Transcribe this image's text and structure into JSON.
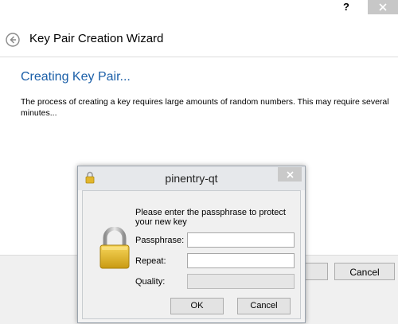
{
  "window": {
    "help_label": "?"
  },
  "wizard": {
    "title": "Key Pair Creation Wizard",
    "heading": "Creating Key Pair...",
    "body": "The process of creating a key requires large amounts of random numbers. This may require several minutes...",
    "cancel_label": "Cancel"
  },
  "dialog": {
    "title": "pinentry-qt",
    "prompt": "Please enter the passphrase to protect your new key",
    "passphrase_label": "Passphrase:",
    "passphrase_value": "",
    "repeat_label": "Repeat:",
    "repeat_value": "",
    "quality_label": "Quality:",
    "ok_label": "OK",
    "cancel_label": "Cancel"
  },
  "colors": {
    "heading_blue": "#1b5fa8",
    "footer_gray": "#f0f0f0",
    "lock_gold": "#e2b62c"
  },
  "icons": {
    "back": "back-arrow-icon",
    "close": "close-icon",
    "dialog_lock": "lock-icon",
    "padlock": "padlock-icon"
  }
}
